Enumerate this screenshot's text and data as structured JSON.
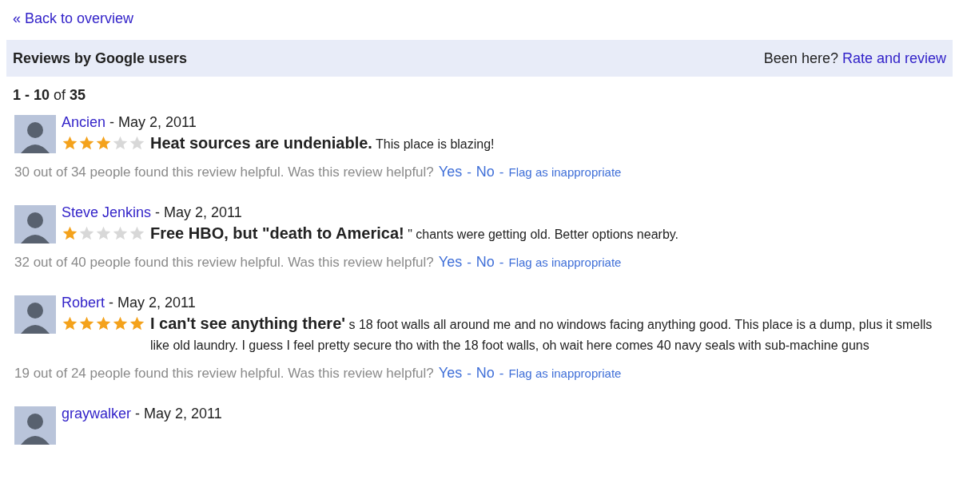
{
  "back_link": "« Back to overview",
  "header": {
    "title": "Reviews by Google users",
    "prompt": "Been here?",
    "action": "Rate and review"
  },
  "range": {
    "bold": "1 - 10",
    "middle": "of",
    "total": "35"
  },
  "reviews": [
    {
      "author": "Ancien",
      "date": "- May 2, 2011",
      "stars": 3,
      "text": "**Heat sources are undeniable.** This place is blazing!",
      "helpful": "30 out of 34 people found this review helpful. Was this review helpful?",
      "actions": [
        {
          "kind": "link",
          "text": "Yes"
        },
        {
          "kind": "separator",
          "text": "-"
        },
        {
          "kind": "link",
          "text": "No"
        },
        {
          "kind": "separator",
          "text": "-"
        },
        {
          "kind": "flag",
          "text": "Flag as inappropriate"
        }
      ]
    },
    {
      "author": "Steve Jenkins",
      "date": "- May 2, 2011",
      "stars": 1,
      "text": "**Free HBO, but \"death to America!** \" chants were getting old. Better options nearby.",
      "helpful": "32 out of 40 people found this review helpful. Was this review helpful?",
      "actions": [
        {
          "kind": "link",
          "text": "Yes"
        },
        {
          "kind": "separator",
          "text": "-"
        },
        {
          "kind": "link",
          "text": "No"
        },
        {
          "kind": "separator",
          "text": "-"
        },
        {
          "kind": "flag",
          "text": "Flag as inappropriate"
        }
      ]
    },
    {
      "author": "Robert",
      "date": "- May 2, 2011",
      "stars": 5,
      "text": "**I can't see anything there'** s 18 foot walls all around me and no windows facing anything good. This place is a dump, plus it smells like old laundry. I guess I feel pretty secure tho with the 18 foot walls, oh wait here comes 40 navy seals with sub-machine guns",
      "helpful": "19 out of 24 people found this review helpful. Was this review helpful?",
      "actions": [
        {
          "kind": "link",
          "text": "Yes"
        },
        {
          "kind": "separator",
          "text": "-"
        },
        {
          "kind": "link",
          "text": "No"
        },
        {
          "kind": "separator",
          "text": "-"
        },
        {
          "kind": "flag",
          "text": "Flag as inappropriate"
        }
      ]
    },
    {
      "author": "graywalker",
      "date": "- May 2, 2011"
    }
  ]
}
